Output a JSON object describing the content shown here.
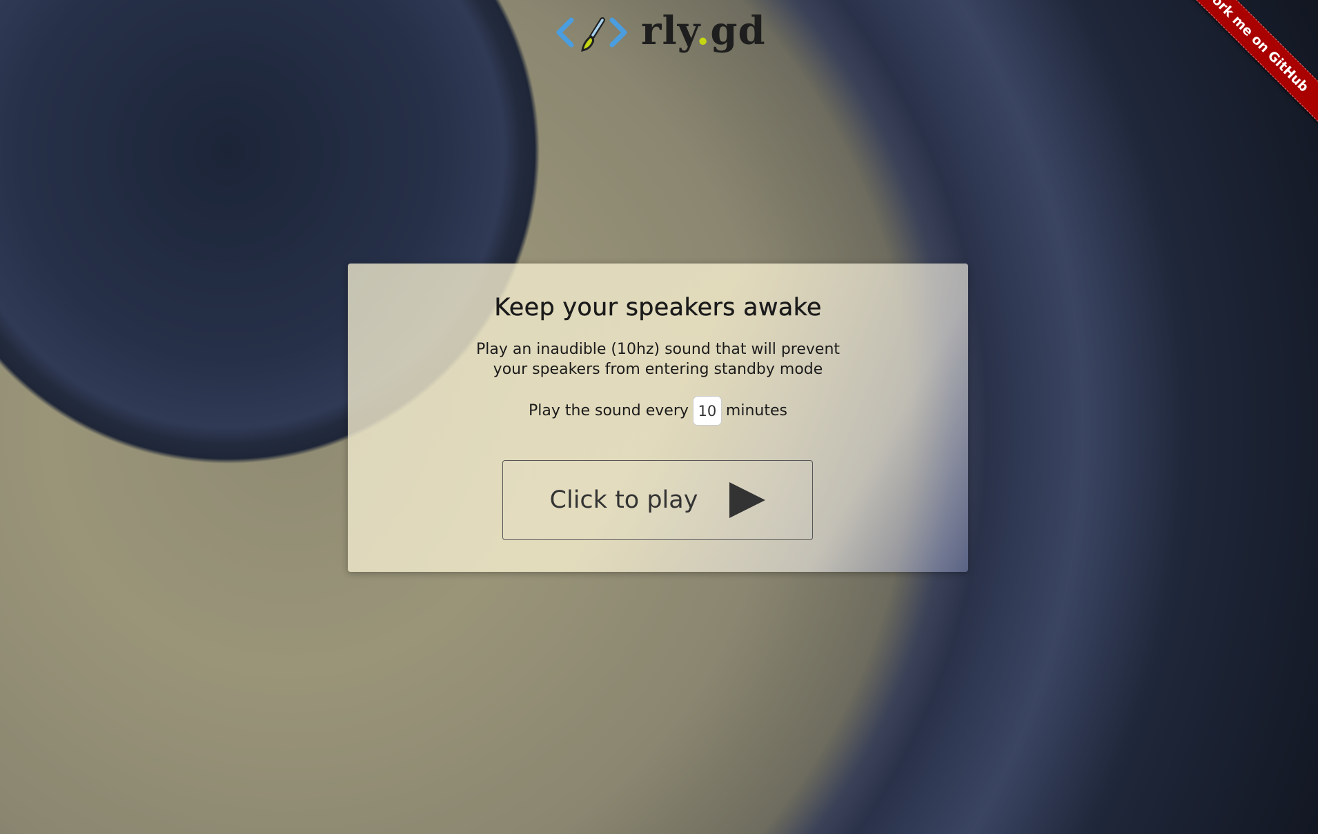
{
  "logo": {
    "text_main": "rly",
    "text_dot": ".",
    "text_end": "gd",
    "icon": "code-paintbrush-icon"
  },
  "ribbon": {
    "label": "Fork me on GitHub"
  },
  "card": {
    "title": "Keep your speakers awake",
    "description_line1": "Play an inaudible (10hz) sound that will prevent",
    "description_line2": "your speakers from entering standby mode",
    "interval_prefix": "Play the sound every",
    "interval_value": "10",
    "interval_suffix": "minutes",
    "play_label": "Click to play"
  },
  "colors": {
    "ribbon": "#a90000",
    "logo_accent": "#c4d614",
    "logo_brackets": "#4a9ee0"
  }
}
